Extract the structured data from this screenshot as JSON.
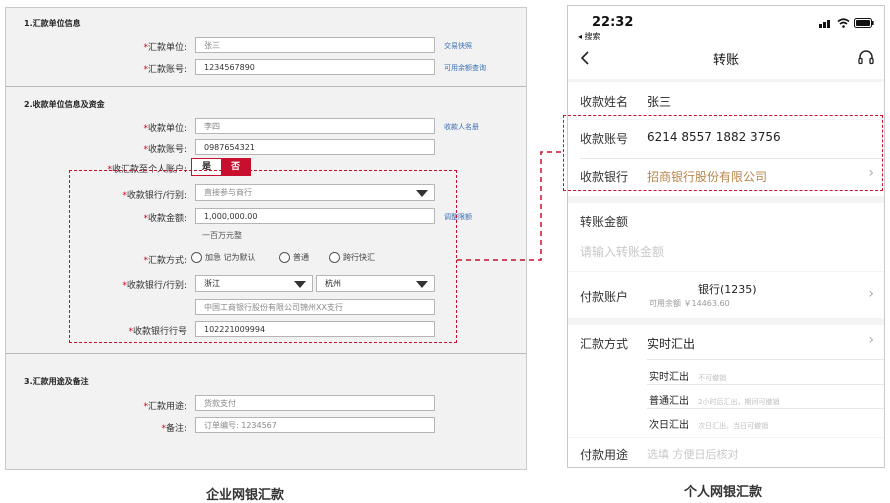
{
  "enterprise": {
    "section1_title": "1.汇款单位信息",
    "remitter_unit_label": "汇款单位:",
    "remitter_unit_value": "张三",
    "remitter_account_label": "汇款账号:",
    "remitter_account_value": "1234567890",
    "link_quick_txn": "交易快照",
    "link_balance_query": "可用余额查询",
    "section2_title": "2.收款单位信息及资金",
    "payee_unit_label": "收款单位:",
    "payee_unit_value": "李四",
    "payee_account_label": "收款账号:",
    "payee_account_value": "0987654321",
    "link_payee_list": "收款人名册",
    "personal_account_label": "收汇款至个人账户:",
    "toggle_yes": "是",
    "toggle_no": "否",
    "payee_bank_label": "收款银行/行别:",
    "payee_bank_value": "直接参与商行",
    "amount_label": "收款金额:",
    "amount_value": "1,000,000.00",
    "amount_caps": "一百万元整",
    "link_adjust_limit": "调整限额",
    "method_label": "汇款方式:",
    "method_options": [
      "加急 记为默认",
      "普通",
      "跨行快汇"
    ],
    "payee_bank2_label": "收款银行/行别:",
    "province_value": "浙江",
    "city_value": "杭州",
    "branch_value": "中国工商银行股份有限公司锦州XX支行",
    "bank_code_label": "收款银行行号",
    "bank_code_value": "102221009994",
    "section3_title": "3.汇款用途及备注",
    "purpose_label": "汇款用途:",
    "purpose_value": "货款支付",
    "remark_label": "备注:",
    "remark_value": "订单编号: 1234567",
    "caption": "企业网银汇款"
  },
  "phone": {
    "time": "22:32",
    "back_to": "◂ 搜索",
    "title": "转账",
    "payee_name_label": "收款姓名",
    "payee_name_value": "张三",
    "payee_account_label": "收款账号",
    "payee_account_value": "6214 8557 1882 3756",
    "payee_bank_label": "收款银行",
    "payee_bank_value": "招商银行股份有限公司",
    "amount_label": "转账金额",
    "amount_placeholder": "请输入转账金额",
    "pay_account_label": "付款账户",
    "pay_account_bank": "银行(1235)",
    "pay_account_balance": "可用余额 ￥14463.60",
    "method_label": "汇款方式",
    "method_value": "实时汇出",
    "method_options": [
      {
        "name": "实时汇出",
        "desc": "不可撤销"
      },
      {
        "name": "普通汇出",
        "desc": "2小时后汇出，期间可撤销"
      },
      {
        "name": "次日汇出",
        "desc": "次日汇出，当日可撤销"
      }
    ],
    "purpose_label": "付款用途",
    "purpose_placeholder": "选填 方便日后核对",
    "caption": "个人网银汇款"
  },
  "colors": {
    "accent_red": "#c8102e",
    "link_blue": "#3b6fb6",
    "bank_gold": "#b8864b"
  },
  "icons": [
    "back-chevron-icon",
    "customer-service-icon",
    "signal-icon",
    "wifi-icon",
    "battery-icon",
    "chevron-right-icon",
    "dropdown-triangle-icon"
  ]
}
